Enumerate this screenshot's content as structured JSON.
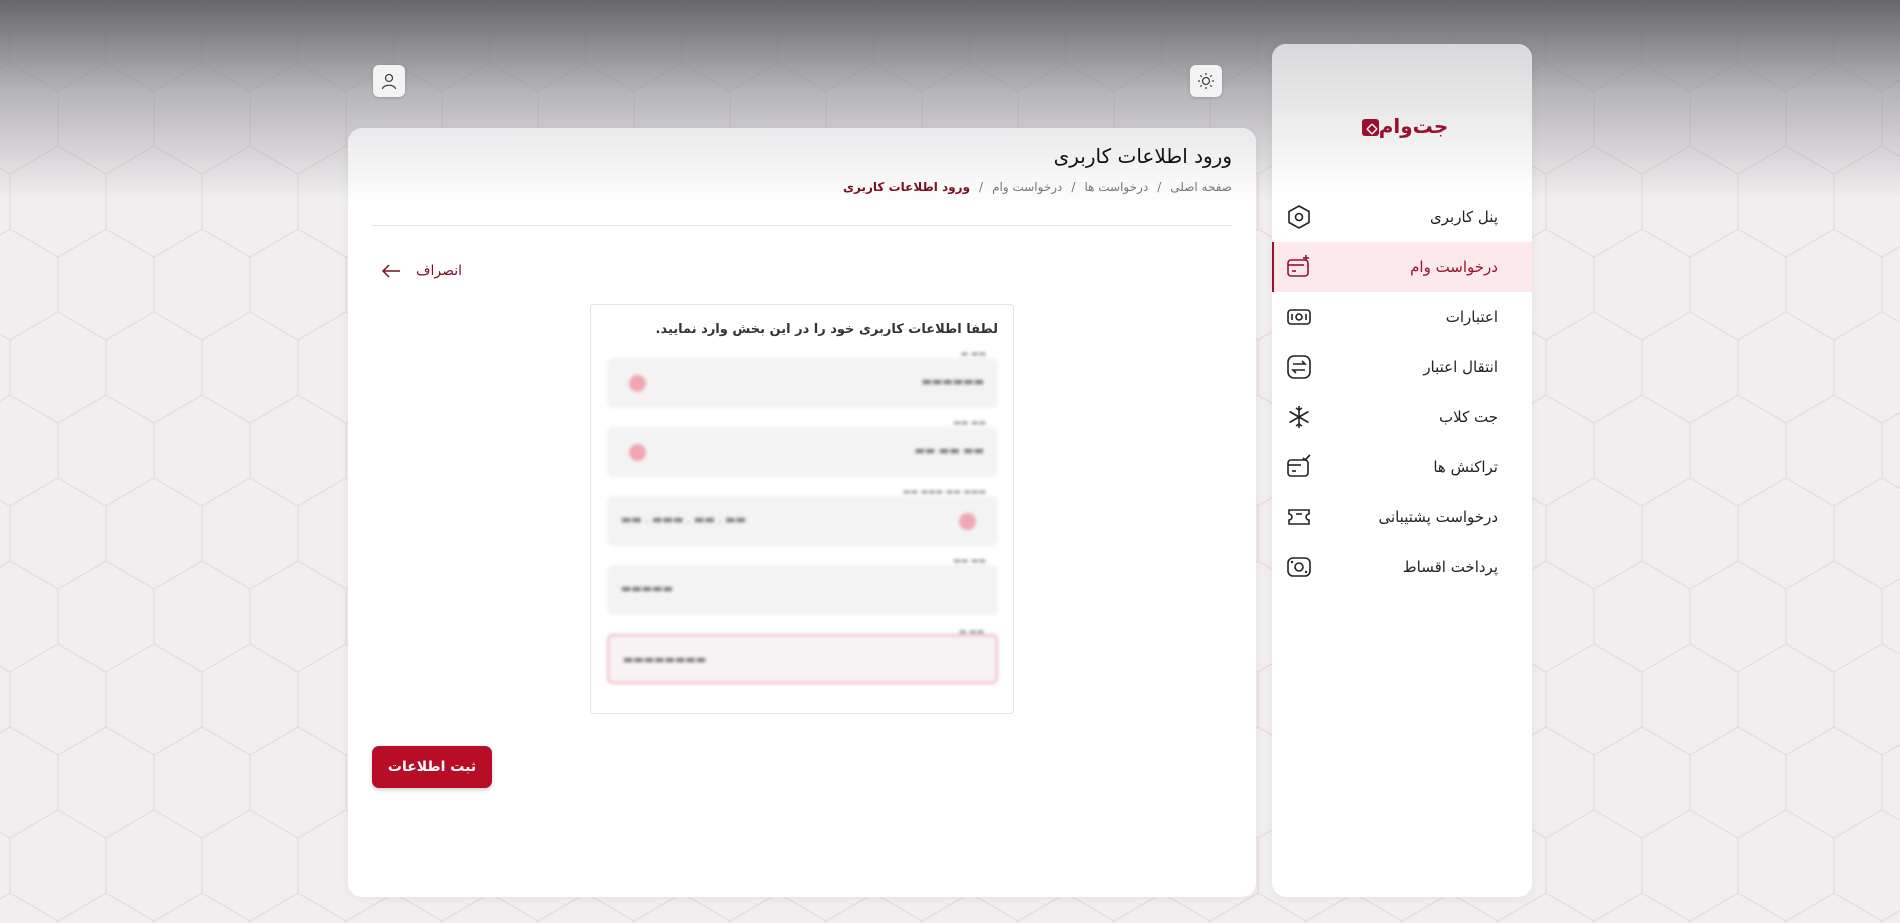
{
  "brand": {
    "logo_text": "جت‌وام",
    "accent": "#9b0f2e",
    "button_color": "#b80d26"
  },
  "header": {
    "theme_icon": "sun-icon",
    "user_icon": "user-icon"
  },
  "sidebar": {
    "items": [
      {
        "label": "پنل کاربری",
        "icon": "hexagon-icon",
        "active": false
      },
      {
        "label": "درخواست وام",
        "icon": "card-add-icon",
        "active": true
      },
      {
        "label": "اعتبارات",
        "icon": "cash-icon",
        "active": false
      },
      {
        "label": "انتقال اعتبار",
        "icon": "transfer-icon",
        "active": false
      },
      {
        "label": "جت کلاب",
        "icon": "snowflake-icon",
        "active": false
      },
      {
        "label": "تراکنش ها",
        "icon": "card-check-icon",
        "active": false
      },
      {
        "label": "درخواست پشتیبانی",
        "icon": "ticket-icon",
        "active": false
      },
      {
        "label": "پرداخت اقساط",
        "icon": "money-icon",
        "active": false
      }
    ]
  },
  "main": {
    "title": "ورود اطلاعات کاربری",
    "breadcrumb": [
      "صفحه اصلی",
      "درخواست ها",
      "درخواست وام",
      "ورود اطلاعات کاربری"
    ],
    "breadcrumb_separator": "/",
    "cancel_label": "انصراف",
    "form": {
      "hint": "لطفا اطلاعات کاربری خود را در این بخش وارد نمایید.",
      "submit_label": "ثبت اطلاعات"
    }
  }
}
